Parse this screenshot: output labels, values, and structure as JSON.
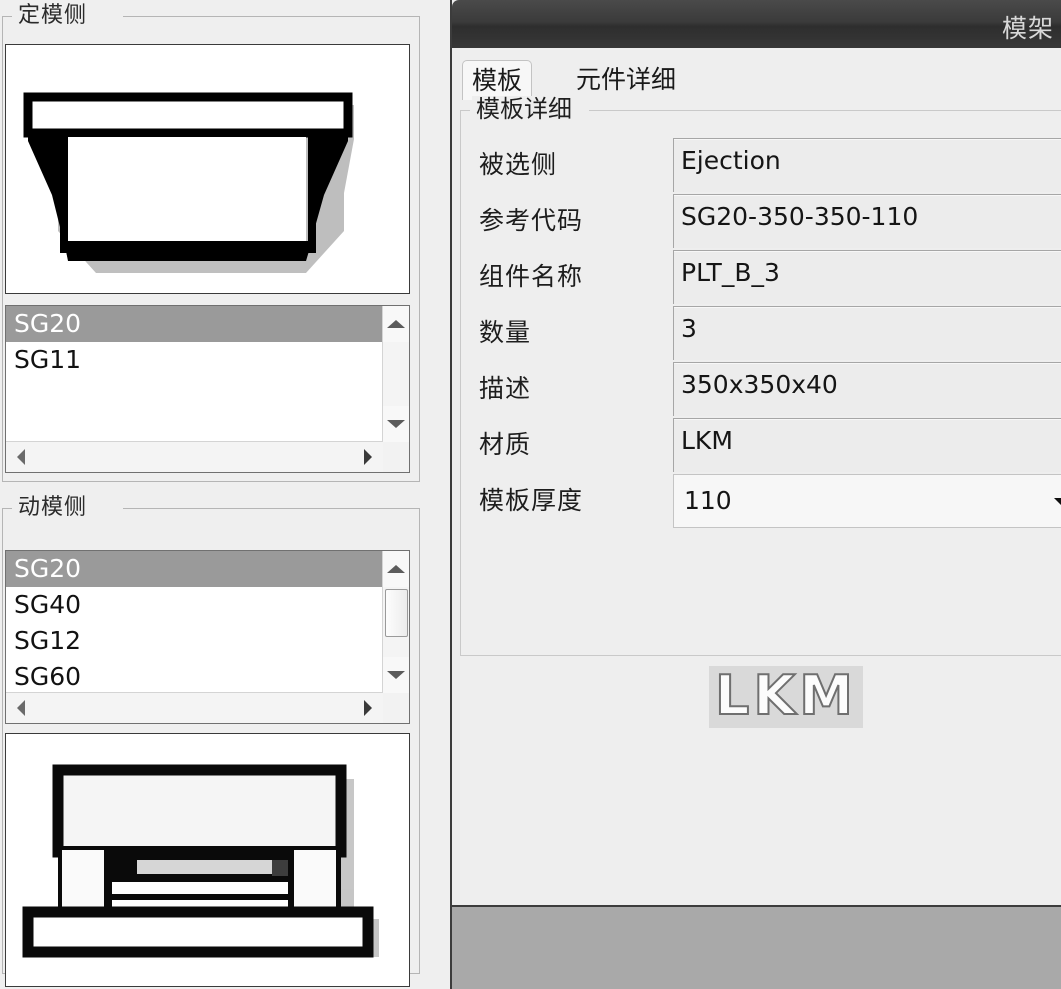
{
  "window": {
    "title": "模架"
  },
  "left_panel": {
    "fixed_side": {
      "group_title": "定模侧",
      "preview_name": "fixed-side-mold-diagram",
      "list": {
        "items": [
          {
            "label": "SG20",
            "selected": true
          },
          {
            "label": "SG11",
            "selected": false
          }
        ]
      }
    },
    "moving_side": {
      "group_title": "动模侧",
      "preview_name": "moving-side-mold-diagram",
      "list": {
        "items": [
          {
            "label": "SG20",
            "selected": true
          },
          {
            "label": "SG40",
            "selected": false
          },
          {
            "label": "SG12",
            "selected": false
          },
          {
            "label": "SG60",
            "selected": false
          }
        ]
      }
    }
  },
  "dialog": {
    "tabs": [
      {
        "label": "模板",
        "active": true
      },
      {
        "label": "元件详细",
        "active": false
      }
    ],
    "group_title": "模板详细",
    "fields": [
      {
        "label": "被选侧",
        "value": "Ejection",
        "type": "text"
      },
      {
        "label": "参考代码",
        "value": "SG20-350-350-110",
        "type": "text"
      },
      {
        "label": "组件名称",
        "value": "PLT_B_3",
        "type": "text"
      },
      {
        "label": "数量",
        "value": "3",
        "type": "text"
      },
      {
        "label": "描述",
        "value": "350x350x40",
        "type": "text"
      },
      {
        "label": "材质",
        "value": "LKM",
        "type": "text"
      },
      {
        "label": "模板厚度",
        "value": "110",
        "type": "combo"
      }
    ],
    "logo": "LKM"
  },
  "colors": {
    "window_bg": "#efefef",
    "titlebar": "#3b3b3b",
    "selection": "#9a9a9a",
    "field_bg": "#ececec",
    "bottom_strip": "#a9a9a9"
  }
}
